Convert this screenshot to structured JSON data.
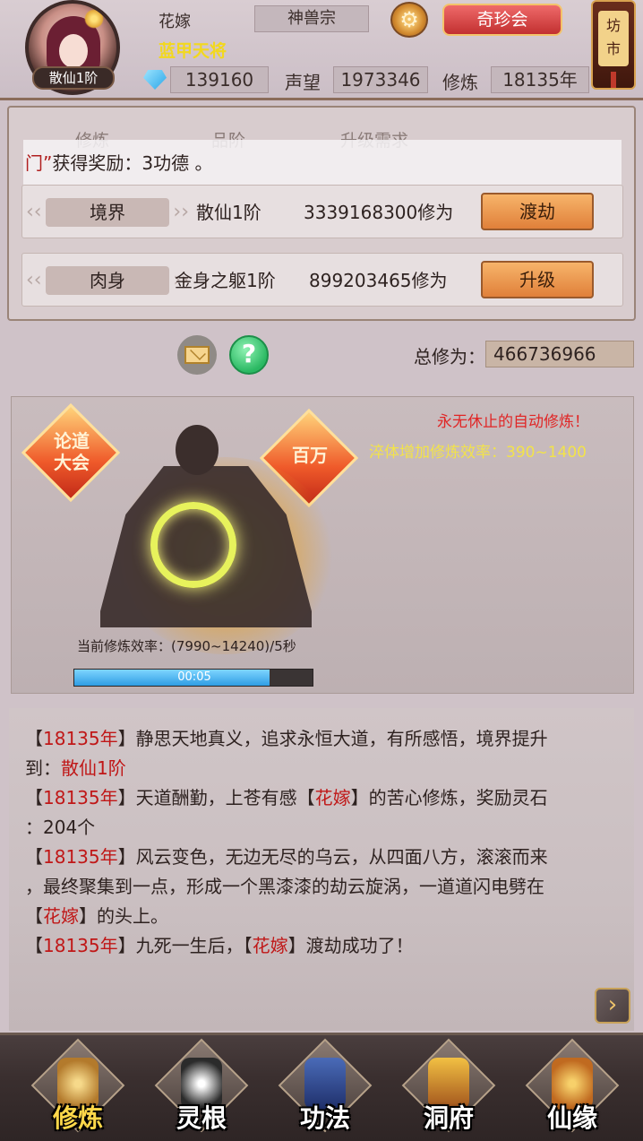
{
  "player": {
    "name": "花嫁",
    "sect": "神兽宗",
    "title": "蓝甲天将",
    "rank": "散仙1阶",
    "gems": "139160",
    "reputation_label": "声望",
    "reputation": "1973346",
    "cultivation_label": "修炼",
    "cultivation_years": "18135年"
  },
  "header": {
    "qizhen_label": "奇珍会",
    "fangshi_label": "坊市"
  },
  "table": {
    "col_headers": [
      "修炼",
      "品阶",
      "升级需求"
    ],
    "marquee_red": "门”",
    "marquee_text": "获得奖励：3功德 。"
  },
  "rows": [
    {
      "tag": "境界",
      "stage": "散仙1阶",
      "req": "3339168300修为",
      "button": "渡劫"
    },
    {
      "tag": "肉身",
      "stage": "金身之躯1阶",
      "req": "899203465修为",
      "button": "升级"
    }
  ],
  "total": {
    "label": "总修为：",
    "value": "466736966"
  },
  "meditation": {
    "auto_text": "永无休止的自动修炼！",
    "efficiency_text": "淬体增加修炼效率：390~1400",
    "lundao_badge": "论道大会",
    "baiwan_badge": "百万",
    "rate_text": "当前修炼效率：(7990~14240)/5秒",
    "progress_time": "00:05",
    "progress_fraction": 0.82
  },
  "log": {
    "lines": [
      {
        "parts": [
          [
            "【",
            ""
          ],
          [
            "18135年",
            "red"
          ],
          [
            "】静思天地真义，追求永恒大道，有所感悟，境界提升",
            ""
          ]
        ]
      },
      {
        "parts": [
          [
            "到：",
            ""
          ],
          [
            "散仙1阶",
            "red"
          ]
        ]
      },
      {
        "parts": [
          [
            "【",
            ""
          ],
          [
            "18135年",
            "red"
          ],
          [
            "】天道酬勤，上苍有感【",
            ""
          ],
          [
            "花嫁",
            "red"
          ],
          [
            "】的苦心修炼，奖励灵石",
            ""
          ]
        ]
      },
      {
        "parts": [
          [
            "：204个",
            ""
          ]
        ]
      },
      {
        "parts": [
          [
            "【",
            ""
          ],
          [
            "18135年",
            "red"
          ],
          [
            "】风云变色，无边无尽的乌云，从四面八方，滚滚而来",
            ""
          ]
        ]
      },
      {
        "parts": [
          [
            "，最终聚集到一点，形成一个黑漆漆的劫云旋涡，一道道闪电劈在",
            ""
          ]
        ]
      },
      {
        "parts": [
          [
            "【",
            ""
          ],
          [
            "花嫁",
            "red"
          ],
          [
            "】的头上。",
            ""
          ]
        ]
      },
      {
        "parts": [
          [
            "【",
            ""
          ],
          [
            "18135年",
            "red"
          ],
          [
            "】九死一生后，【",
            ""
          ],
          [
            "花嫁",
            "red"
          ],
          [
            "】渡劫成功了！",
            ""
          ]
        ]
      }
    ]
  },
  "nav": {
    "items": [
      {
        "label": "修炼",
        "active": true
      },
      {
        "label": "灵根",
        "active": false
      },
      {
        "label": "功法",
        "active": false
      },
      {
        "label": "洞府",
        "active": false
      },
      {
        "label": "仙缘",
        "active": false
      }
    ]
  },
  "colors": {
    "accent_red": "#c01717",
    "title_gold": "#f2d81e",
    "button_orange": "#e0803a"
  }
}
